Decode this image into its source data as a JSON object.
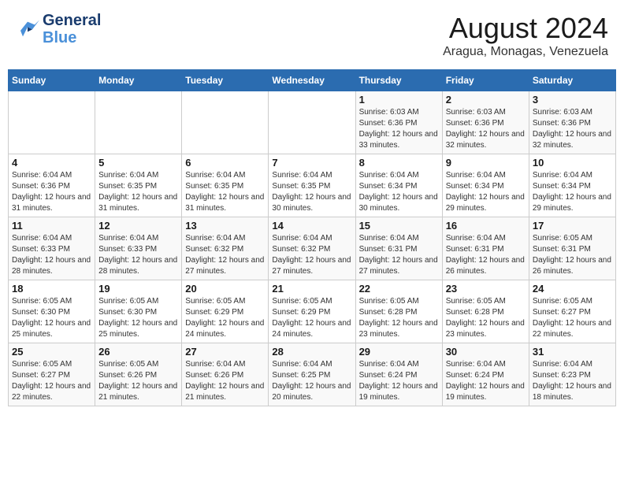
{
  "header": {
    "logo_general": "General",
    "logo_blue": "Blue",
    "month_year": "August 2024",
    "location": "Aragua, Monagas, Venezuela"
  },
  "weekdays": [
    "Sunday",
    "Monday",
    "Tuesday",
    "Wednesday",
    "Thursday",
    "Friday",
    "Saturday"
  ],
  "weeks": [
    [
      {
        "day": "",
        "sunrise": "",
        "sunset": "",
        "daylight": ""
      },
      {
        "day": "",
        "sunrise": "",
        "sunset": "",
        "daylight": ""
      },
      {
        "day": "",
        "sunrise": "",
        "sunset": "",
        "daylight": ""
      },
      {
        "day": "",
        "sunrise": "",
        "sunset": "",
        "daylight": ""
      },
      {
        "day": "1",
        "sunrise": "Sunrise: 6:03 AM",
        "sunset": "Sunset: 6:36 PM",
        "daylight": "Daylight: 12 hours and 33 minutes."
      },
      {
        "day": "2",
        "sunrise": "Sunrise: 6:03 AM",
        "sunset": "Sunset: 6:36 PM",
        "daylight": "Daylight: 12 hours and 32 minutes."
      },
      {
        "day": "3",
        "sunrise": "Sunrise: 6:03 AM",
        "sunset": "Sunset: 6:36 PM",
        "daylight": "Daylight: 12 hours and 32 minutes."
      }
    ],
    [
      {
        "day": "4",
        "sunrise": "Sunrise: 6:04 AM",
        "sunset": "Sunset: 6:36 PM",
        "daylight": "Daylight: 12 hours and 31 minutes."
      },
      {
        "day": "5",
        "sunrise": "Sunrise: 6:04 AM",
        "sunset": "Sunset: 6:35 PM",
        "daylight": "Daylight: 12 hours and 31 minutes."
      },
      {
        "day": "6",
        "sunrise": "Sunrise: 6:04 AM",
        "sunset": "Sunset: 6:35 PM",
        "daylight": "Daylight: 12 hours and 31 minutes."
      },
      {
        "day": "7",
        "sunrise": "Sunrise: 6:04 AM",
        "sunset": "Sunset: 6:35 PM",
        "daylight": "Daylight: 12 hours and 30 minutes."
      },
      {
        "day": "8",
        "sunrise": "Sunrise: 6:04 AM",
        "sunset": "Sunset: 6:34 PM",
        "daylight": "Daylight: 12 hours and 30 minutes."
      },
      {
        "day": "9",
        "sunrise": "Sunrise: 6:04 AM",
        "sunset": "Sunset: 6:34 PM",
        "daylight": "Daylight: 12 hours and 29 minutes."
      },
      {
        "day": "10",
        "sunrise": "Sunrise: 6:04 AM",
        "sunset": "Sunset: 6:34 PM",
        "daylight": "Daylight: 12 hours and 29 minutes."
      }
    ],
    [
      {
        "day": "11",
        "sunrise": "Sunrise: 6:04 AM",
        "sunset": "Sunset: 6:33 PM",
        "daylight": "Daylight: 12 hours and 28 minutes."
      },
      {
        "day": "12",
        "sunrise": "Sunrise: 6:04 AM",
        "sunset": "Sunset: 6:33 PM",
        "daylight": "Daylight: 12 hours and 28 minutes."
      },
      {
        "day": "13",
        "sunrise": "Sunrise: 6:04 AM",
        "sunset": "Sunset: 6:32 PM",
        "daylight": "Daylight: 12 hours and 27 minutes."
      },
      {
        "day": "14",
        "sunrise": "Sunrise: 6:04 AM",
        "sunset": "Sunset: 6:32 PM",
        "daylight": "Daylight: 12 hours and 27 minutes."
      },
      {
        "day": "15",
        "sunrise": "Sunrise: 6:04 AM",
        "sunset": "Sunset: 6:31 PM",
        "daylight": "Daylight: 12 hours and 27 minutes."
      },
      {
        "day": "16",
        "sunrise": "Sunrise: 6:04 AM",
        "sunset": "Sunset: 6:31 PM",
        "daylight": "Daylight: 12 hours and 26 minutes."
      },
      {
        "day": "17",
        "sunrise": "Sunrise: 6:05 AM",
        "sunset": "Sunset: 6:31 PM",
        "daylight": "Daylight: 12 hours and 26 minutes."
      }
    ],
    [
      {
        "day": "18",
        "sunrise": "Sunrise: 6:05 AM",
        "sunset": "Sunset: 6:30 PM",
        "daylight": "Daylight: 12 hours and 25 minutes."
      },
      {
        "day": "19",
        "sunrise": "Sunrise: 6:05 AM",
        "sunset": "Sunset: 6:30 PM",
        "daylight": "Daylight: 12 hours and 25 minutes."
      },
      {
        "day": "20",
        "sunrise": "Sunrise: 6:05 AM",
        "sunset": "Sunset: 6:29 PM",
        "daylight": "Daylight: 12 hours and 24 minutes."
      },
      {
        "day": "21",
        "sunrise": "Sunrise: 6:05 AM",
        "sunset": "Sunset: 6:29 PM",
        "daylight": "Daylight: 12 hours and 24 minutes."
      },
      {
        "day": "22",
        "sunrise": "Sunrise: 6:05 AM",
        "sunset": "Sunset: 6:28 PM",
        "daylight": "Daylight: 12 hours and 23 minutes."
      },
      {
        "day": "23",
        "sunrise": "Sunrise: 6:05 AM",
        "sunset": "Sunset: 6:28 PM",
        "daylight": "Daylight: 12 hours and 23 minutes."
      },
      {
        "day": "24",
        "sunrise": "Sunrise: 6:05 AM",
        "sunset": "Sunset: 6:27 PM",
        "daylight": "Daylight: 12 hours and 22 minutes."
      }
    ],
    [
      {
        "day": "25",
        "sunrise": "Sunrise: 6:05 AM",
        "sunset": "Sunset: 6:27 PM",
        "daylight": "Daylight: 12 hours and 22 minutes."
      },
      {
        "day": "26",
        "sunrise": "Sunrise: 6:05 AM",
        "sunset": "Sunset: 6:26 PM",
        "daylight": "Daylight: 12 hours and 21 minutes."
      },
      {
        "day": "27",
        "sunrise": "Sunrise: 6:04 AM",
        "sunset": "Sunset: 6:26 PM",
        "daylight": "Daylight: 12 hours and 21 minutes."
      },
      {
        "day": "28",
        "sunrise": "Sunrise: 6:04 AM",
        "sunset": "Sunset: 6:25 PM",
        "daylight": "Daylight: 12 hours and 20 minutes."
      },
      {
        "day": "29",
        "sunrise": "Sunrise: 6:04 AM",
        "sunset": "Sunset: 6:24 PM",
        "daylight": "Daylight: 12 hours and 19 minutes."
      },
      {
        "day": "30",
        "sunrise": "Sunrise: 6:04 AM",
        "sunset": "Sunset: 6:24 PM",
        "daylight": "Daylight: 12 hours and 19 minutes."
      },
      {
        "day": "31",
        "sunrise": "Sunrise: 6:04 AM",
        "sunset": "Sunset: 6:23 PM",
        "daylight": "Daylight: 12 hours and 18 minutes."
      }
    ]
  ]
}
